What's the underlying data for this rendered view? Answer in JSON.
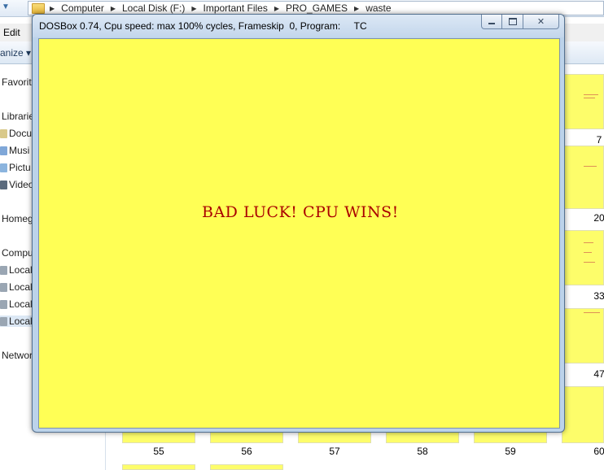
{
  "explorer": {
    "breadcrumb": [
      "Computer",
      "Local Disk (F:)",
      "Important Files",
      "PRO_GAMES",
      "waste"
    ],
    "menu": {
      "edit": "Edit"
    },
    "toolbar": {
      "organize": "anize ▾"
    },
    "nav": {
      "favorites": "Favorite",
      "libraries": "Librarie",
      "documents": "Docu",
      "music": "Musi",
      "pictures": "Pictu",
      "videos": "Video",
      "homegroup": "Homeg",
      "computer": "Compu",
      "drives": [
        "Local",
        "Local",
        "Local",
        "Local"
      ],
      "network": "Networ"
    },
    "thumbnail_labels": {
      "r7": "7",
      "r20": "20",
      "r33": "33",
      "r47": "47",
      "bottom": [
        "55",
        "56",
        "57",
        "58",
        "59",
        "60"
      ]
    }
  },
  "dosbox": {
    "title": "DOSBox 0.74, Cpu speed: max 100% cycles, Frameskip  0, Program:     TC",
    "buttons": {
      "minimize": "minimize",
      "maximize": "maximize",
      "close": "✕"
    },
    "screen_color": "#ffff55",
    "message": "BAD LUCK! CPU WINS!",
    "message_color": "#aa0000"
  }
}
